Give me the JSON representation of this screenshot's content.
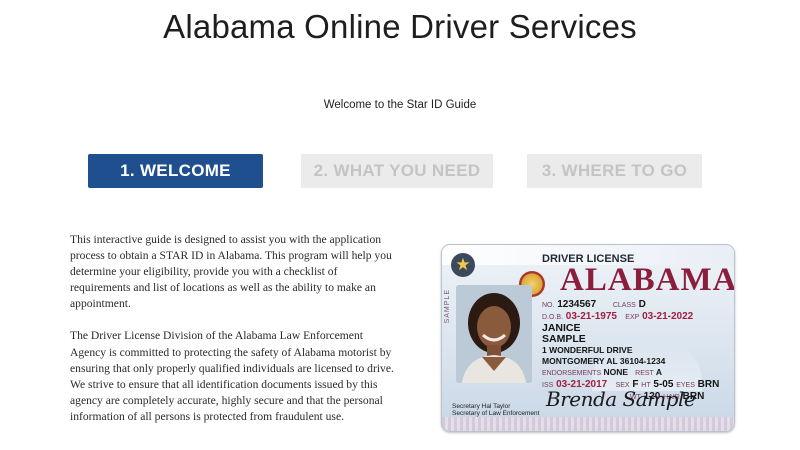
{
  "header": {
    "title": "Alabama Online Driver Services",
    "subtitle": "Welcome to the Star ID Guide"
  },
  "steps": [
    {
      "label": "1. WELCOME",
      "active": true
    },
    {
      "label": "2. WHAT YOU NEED",
      "active": false
    },
    {
      "label": "3. WHERE TO GO",
      "active": false
    }
  ],
  "content": {
    "paragraph1": "This interactive guide is designed to assist you with the application process to obtain a STAR ID in Alabama. This program will help you determine your eligibility, provide you with a checklist of requirements and list of locations as well as the ability to make an appointment.",
    "paragraph2": "The Driver License Division of the Alabama Law Enforcement Agency is committed to protecting the safety of Alabama motorist by ensuring that only properly qualified individuals are licensed to drive. We strive to ensure that all identification documents issued by this agency are completely accurate, highly secure and that the personal information of all persons is protected from fraudulent use."
  },
  "license": {
    "header_label": "DRIVER LICENSE",
    "state": "ALABAMA",
    "no_label": "NO.",
    "number": "1234567",
    "class_label": "CLASS",
    "class_value": "D",
    "dob_label": "D.O.B.",
    "dob": "03-21-1975",
    "exp_label": "EXP",
    "exp": "03-21-2022",
    "first_name": "JANICE",
    "last_name": "SAMPLE",
    "address1": "1 WONDERFUL DRIVE",
    "address2": "MONTGOMERY AL 36104-1234",
    "endorsements_label": "ENDORSEMENTS",
    "endorsements": "NONE",
    "rest_label": "REST",
    "rest": "A",
    "iss_label": "ISS",
    "iss": "03-21-2017",
    "sex_label": "SEX",
    "sex": "F",
    "ht_label": "HT",
    "ht": "5-05",
    "eyes_label": "EYES",
    "eyes": "BRN",
    "wt_label": "WT",
    "wt": "120",
    "hair_label": "HAIR",
    "hair": "BRN",
    "signature": "Brenda Sample",
    "secretary": "Secretary Hal Taylor",
    "secretary_title": "Secretary of Law Enforcement",
    "vertical_text": "SAMPLE",
    "star_icon": "star-icon"
  }
}
